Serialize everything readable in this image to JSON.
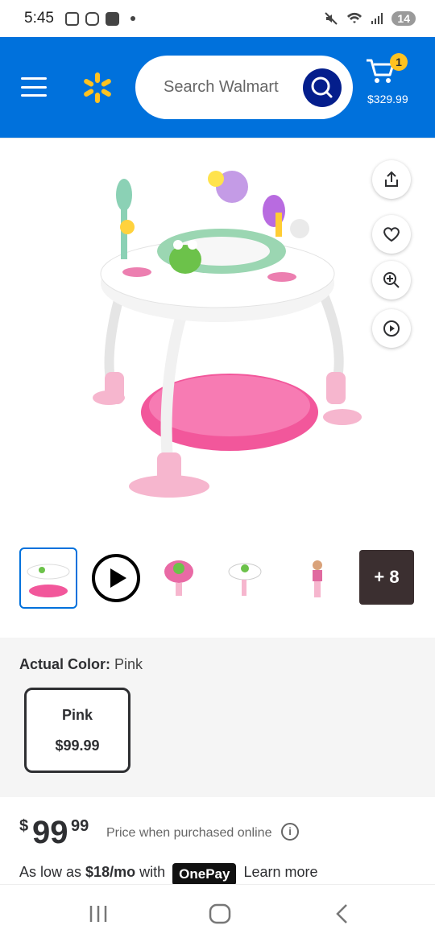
{
  "status": {
    "time": "5:45",
    "battery": "14",
    "icons": [
      "gallery-icon",
      "instagram-icon",
      "alert-icon",
      "mute-icon",
      "wifi-icon",
      "signal-icon"
    ]
  },
  "header": {
    "search_placeholder": "Search Walmart",
    "cart_count": "1",
    "cart_total": "$329.99",
    "brand_color": "#0071dc",
    "accent": "#ffc220"
  },
  "gallery": {
    "more_label": "+ 8"
  },
  "variant": {
    "label": "Actual Color:",
    "value": "Pink",
    "option_name": "Pink",
    "option_price": "$99.99"
  },
  "price": {
    "currency": "$",
    "dollars": "99",
    "cents": "99",
    "note": "Price when purchased online"
  },
  "financing": {
    "prefix": "As low as",
    "monthly": "$18/mo",
    "with": "with",
    "brand": "OnePay",
    "link": "Learn more"
  }
}
